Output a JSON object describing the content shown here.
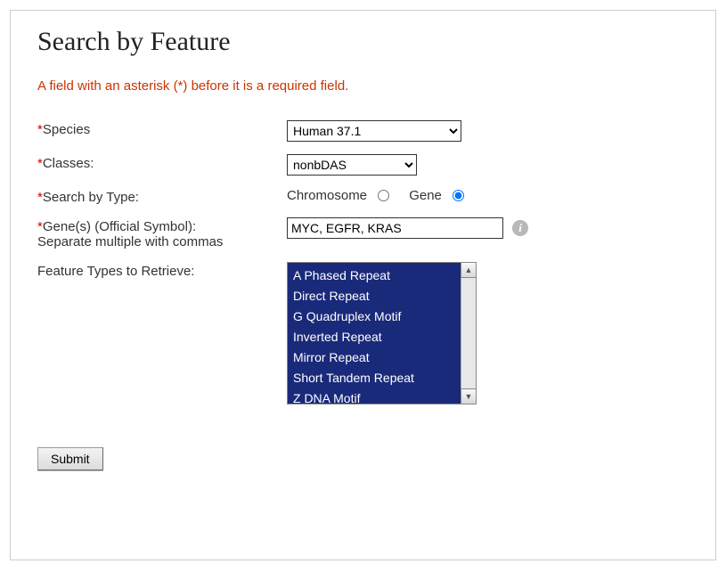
{
  "page": {
    "title": "Search by Feature",
    "required_note": "A field with an asterisk (*) before it is a required field."
  },
  "form": {
    "species": {
      "label": "Species",
      "required": true,
      "value": "Human 37.1",
      "options": [
        "Human 37.1"
      ]
    },
    "classes": {
      "label": "Classes:",
      "required": true,
      "value": "nonbDAS",
      "options": [
        "nonbDAS"
      ]
    },
    "search_type": {
      "label": "Search by Type:",
      "required": true,
      "options": {
        "chromosome": "Chromosome",
        "gene": "Gene"
      },
      "selected": "gene"
    },
    "genes": {
      "label": "Gene(s) (Official Symbol):",
      "sublabel": "Separate multiple with commas",
      "required": true,
      "value": "MYC, EGFR, KRAS"
    },
    "feature_types": {
      "label": "Feature Types to Retrieve:",
      "required": false,
      "options": [
        "A Phased Repeat",
        "Direct Repeat",
        "G Quadruplex Motif",
        "Inverted Repeat",
        "Mirror Repeat",
        "Short Tandem Repeat",
        "Z DNA Motif"
      ]
    },
    "submit_label": "Submit"
  },
  "asterisk": "*"
}
